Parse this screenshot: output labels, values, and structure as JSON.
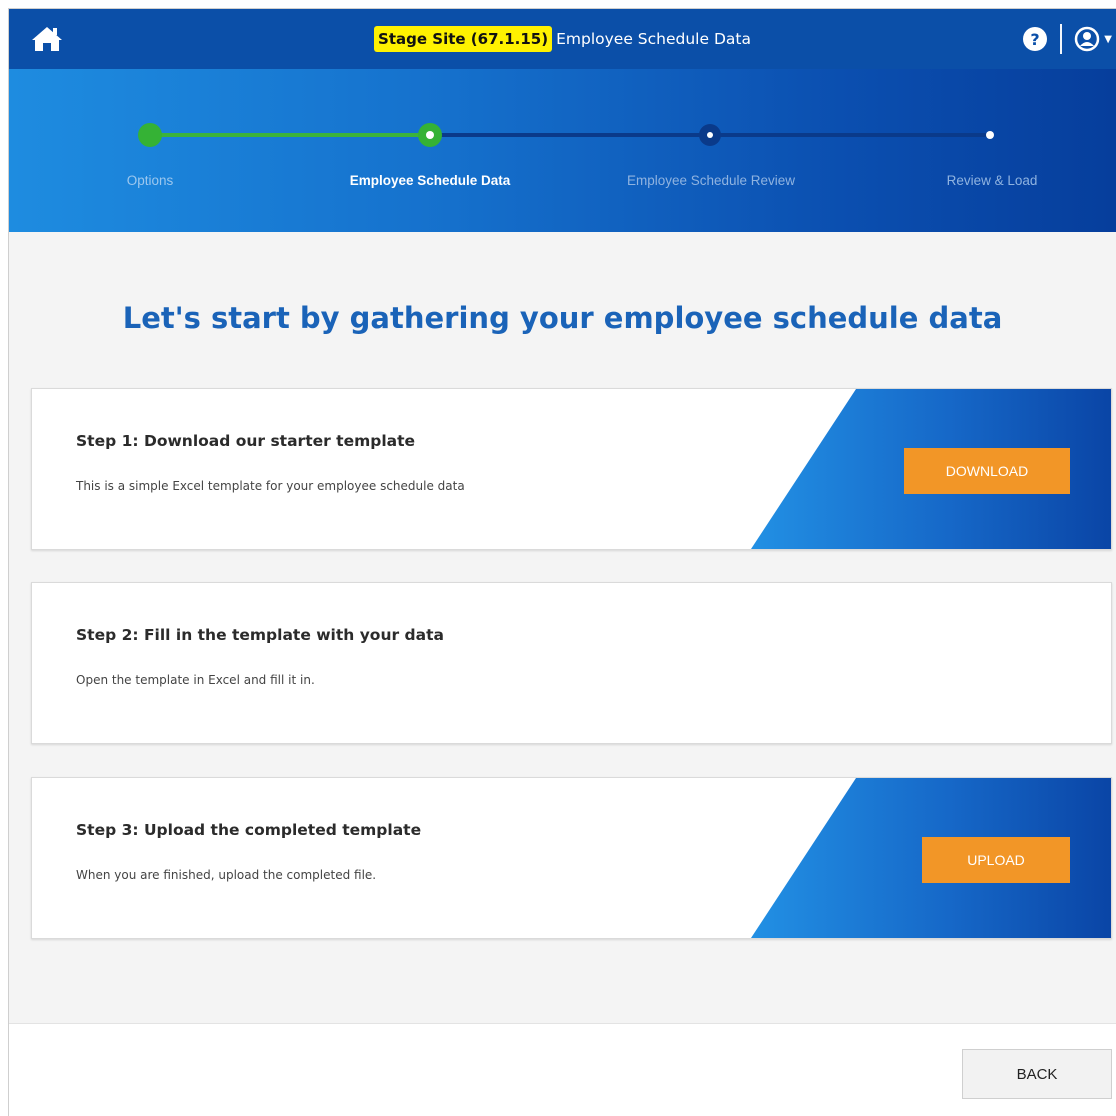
{
  "header": {
    "stage_badge": "Stage Site (67.1.15)",
    "title": "Employee Schedule Data",
    "icons": {
      "home": "home-icon",
      "help": "help-icon",
      "user": "user-icon",
      "caret": "chevron-down-icon"
    },
    "caret_glyph": "▼"
  },
  "stepper": {
    "steps": [
      {
        "label": "Options",
        "state": "complete"
      },
      {
        "label": "Employee Schedule Data",
        "state": "current"
      },
      {
        "label": "Employee Schedule Review",
        "state": "upcoming"
      },
      {
        "label": "Review & Load",
        "state": "upcoming"
      }
    ]
  },
  "main": {
    "headline": "Let's start by gathering your employee schedule data",
    "cards": [
      {
        "title": "Step 1: Download our starter template",
        "description": "This is a simple Excel template for your employee schedule data",
        "button": "DOWNLOAD"
      },
      {
        "title": "Step 2: Fill in the template with your data",
        "description": "Open the template in Excel and fill it in."
      },
      {
        "title": "Step 3: Upload the completed template",
        "description": "When you are finished, upload the completed file.",
        "button": "UPLOAD"
      }
    ]
  },
  "footer": {
    "back_label": "BACK"
  },
  "colors": {
    "header_bg": "#0b4fa8",
    "badge_bg": "#fff200",
    "accent_orange": "#f29627",
    "headline_blue": "#1a63b8",
    "step_complete": "#35b235"
  }
}
